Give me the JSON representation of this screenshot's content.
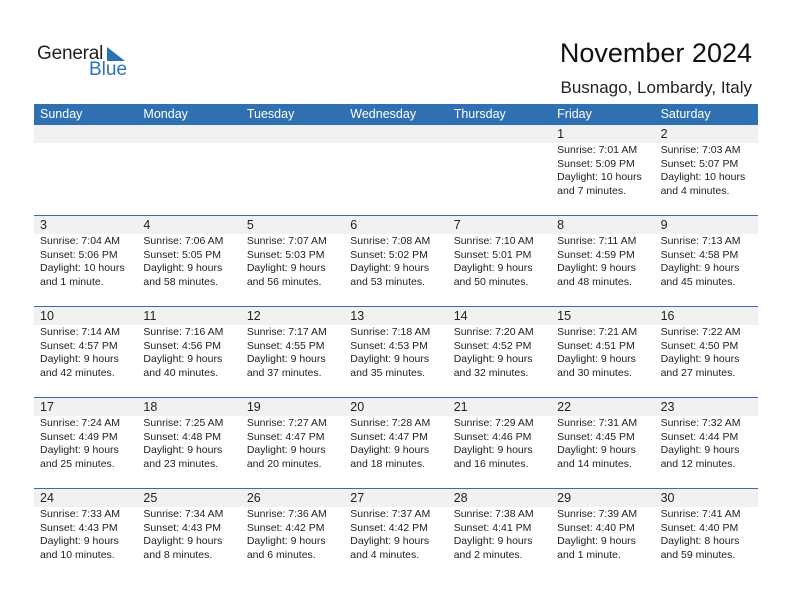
{
  "logo": {
    "line1": "General",
    "line2": "Blue"
  },
  "header": {
    "title": "November 2024",
    "location": "Busnago, Lombardy, Italy"
  },
  "colors": {
    "accent": "#2e70b1",
    "day_band": "#f1f1f1"
  },
  "weekdays": [
    "Sunday",
    "Monday",
    "Tuesday",
    "Wednesday",
    "Thursday",
    "Friday",
    "Saturday"
  ],
  "weeks": [
    [
      null,
      null,
      null,
      null,
      null,
      {
        "day": "1",
        "sunrise": "Sunrise: 7:01 AM",
        "sunset": "Sunset: 5:09 PM",
        "daylight1": "Daylight: 10 hours",
        "daylight2": "and 7 minutes."
      },
      {
        "day": "2",
        "sunrise": "Sunrise: 7:03 AM",
        "sunset": "Sunset: 5:07 PM",
        "daylight1": "Daylight: 10 hours",
        "daylight2": "and 4 minutes."
      }
    ],
    [
      {
        "day": "3",
        "sunrise": "Sunrise: 7:04 AM",
        "sunset": "Sunset: 5:06 PM",
        "daylight1": "Daylight: 10 hours",
        "daylight2": "and 1 minute."
      },
      {
        "day": "4",
        "sunrise": "Sunrise: 7:06 AM",
        "sunset": "Sunset: 5:05 PM",
        "daylight1": "Daylight: 9 hours",
        "daylight2": "and 58 minutes."
      },
      {
        "day": "5",
        "sunrise": "Sunrise: 7:07 AM",
        "sunset": "Sunset: 5:03 PM",
        "daylight1": "Daylight: 9 hours",
        "daylight2": "and 56 minutes."
      },
      {
        "day": "6",
        "sunrise": "Sunrise: 7:08 AM",
        "sunset": "Sunset: 5:02 PM",
        "daylight1": "Daylight: 9 hours",
        "daylight2": "and 53 minutes."
      },
      {
        "day": "7",
        "sunrise": "Sunrise: 7:10 AM",
        "sunset": "Sunset: 5:01 PM",
        "daylight1": "Daylight: 9 hours",
        "daylight2": "and 50 minutes."
      },
      {
        "day": "8",
        "sunrise": "Sunrise: 7:11 AM",
        "sunset": "Sunset: 4:59 PM",
        "daylight1": "Daylight: 9 hours",
        "daylight2": "and 48 minutes."
      },
      {
        "day": "9",
        "sunrise": "Sunrise: 7:13 AM",
        "sunset": "Sunset: 4:58 PM",
        "daylight1": "Daylight: 9 hours",
        "daylight2": "and 45 minutes."
      }
    ],
    [
      {
        "day": "10",
        "sunrise": "Sunrise: 7:14 AM",
        "sunset": "Sunset: 4:57 PM",
        "daylight1": "Daylight: 9 hours",
        "daylight2": "and 42 minutes."
      },
      {
        "day": "11",
        "sunrise": "Sunrise: 7:16 AM",
        "sunset": "Sunset: 4:56 PM",
        "daylight1": "Daylight: 9 hours",
        "daylight2": "and 40 minutes."
      },
      {
        "day": "12",
        "sunrise": "Sunrise: 7:17 AM",
        "sunset": "Sunset: 4:55 PM",
        "daylight1": "Daylight: 9 hours",
        "daylight2": "and 37 minutes."
      },
      {
        "day": "13",
        "sunrise": "Sunrise: 7:18 AM",
        "sunset": "Sunset: 4:53 PM",
        "daylight1": "Daylight: 9 hours",
        "daylight2": "and 35 minutes."
      },
      {
        "day": "14",
        "sunrise": "Sunrise: 7:20 AM",
        "sunset": "Sunset: 4:52 PM",
        "daylight1": "Daylight: 9 hours",
        "daylight2": "and 32 minutes."
      },
      {
        "day": "15",
        "sunrise": "Sunrise: 7:21 AM",
        "sunset": "Sunset: 4:51 PM",
        "daylight1": "Daylight: 9 hours",
        "daylight2": "and 30 minutes."
      },
      {
        "day": "16",
        "sunrise": "Sunrise: 7:22 AM",
        "sunset": "Sunset: 4:50 PM",
        "daylight1": "Daylight: 9 hours",
        "daylight2": "and 27 minutes."
      }
    ],
    [
      {
        "day": "17",
        "sunrise": "Sunrise: 7:24 AM",
        "sunset": "Sunset: 4:49 PM",
        "daylight1": "Daylight: 9 hours",
        "daylight2": "and 25 minutes."
      },
      {
        "day": "18",
        "sunrise": "Sunrise: 7:25 AM",
        "sunset": "Sunset: 4:48 PM",
        "daylight1": "Daylight: 9 hours",
        "daylight2": "and 23 minutes."
      },
      {
        "day": "19",
        "sunrise": "Sunrise: 7:27 AM",
        "sunset": "Sunset: 4:47 PM",
        "daylight1": "Daylight: 9 hours",
        "daylight2": "and 20 minutes."
      },
      {
        "day": "20",
        "sunrise": "Sunrise: 7:28 AM",
        "sunset": "Sunset: 4:47 PM",
        "daylight1": "Daylight: 9 hours",
        "daylight2": "and 18 minutes."
      },
      {
        "day": "21",
        "sunrise": "Sunrise: 7:29 AM",
        "sunset": "Sunset: 4:46 PM",
        "daylight1": "Daylight: 9 hours",
        "daylight2": "and 16 minutes."
      },
      {
        "day": "22",
        "sunrise": "Sunrise: 7:31 AM",
        "sunset": "Sunset: 4:45 PM",
        "daylight1": "Daylight: 9 hours",
        "daylight2": "and 14 minutes."
      },
      {
        "day": "23",
        "sunrise": "Sunrise: 7:32 AM",
        "sunset": "Sunset: 4:44 PM",
        "daylight1": "Daylight: 9 hours",
        "daylight2": "and 12 minutes."
      }
    ],
    [
      {
        "day": "24",
        "sunrise": "Sunrise: 7:33 AM",
        "sunset": "Sunset: 4:43 PM",
        "daylight1": "Daylight: 9 hours",
        "daylight2": "and 10 minutes."
      },
      {
        "day": "25",
        "sunrise": "Sunrise: 7:34 AM",
        "sunset": "Sunset: 4:43 PM",
        "daylight1": "Daylight: 9 hours",
        "daylight2": "and 8 minutes."
      },
      {
        "day": "26",
        "sunrise": "Sunrise: 7:36 AM",
        "sunset": "Sunset: 4:42 PM",
        "daylight1": "Daylight: 9 hours",
        "daylight2": "and 6 minutes."
      },
      {
        "day": "27",
        "sunrise": "Sunrise: 7:37 AM",
        "sunset": "Sunset: 4:42 PM",
        "daylight1": "Daylight: 9 hours",
        "daylight2": "and 4 minutes."
      },
      {
        "day": "28",
        "sunrise": "Sunrise: 7:38 AM",
        "sunset": "Sunset: 4:41 PM",
        "daylight1": "Daylight: 9 hours",
        "daylight2": "and 2 minutes."
      },
      {
        "day": "29",
        "sunrise": "Sunrise: 7:39 AM",
        "sunset": "Sunset: 4:40 PM",
        "daylight1": "Daylight: 9 hours",
        "daylight2": "and 1 minute."
      },
      {
        "day": "30",
        "sunrise": "Sunrise: 7:41 AM",
        "sunset": "Sunset: 4:40 PM",
        "daylight1": "Daylight: 8 hours",
        "daylight2": "and 59 minutes."
      }
    ]
  ]
}
